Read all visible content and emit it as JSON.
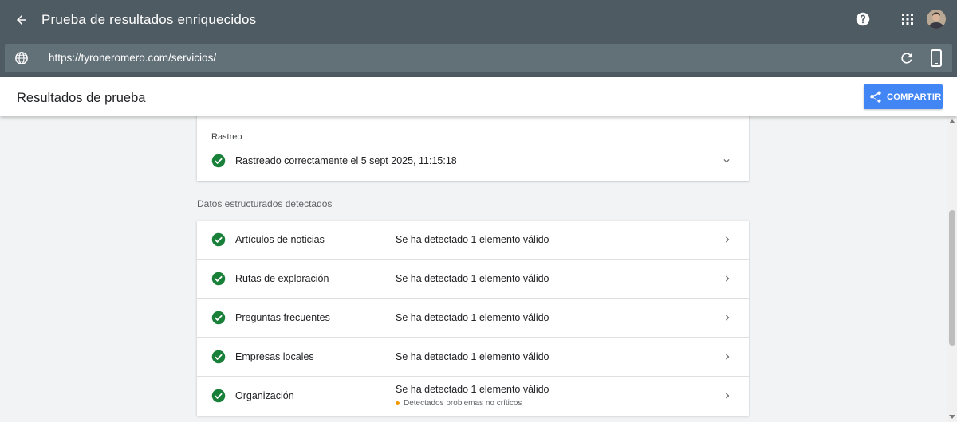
{
  "app": {
    "title": "Prueba de resultados enriquecidos"
  },
  "icons": {
    "back": "arrow-back-icon",
    "help": "help-icon",
    "apps": "apps-grid-icon",
    "globe": "globe-icon",
    "reload": "reload-icon",
    "device": "smartphone-icon",
    "share": "share-icon",
    "check": "check-circle-icon",
    "expand": "chevron-down-icon",
    "next": "chevron-right-icon"
  },
  "url": {
    "value": "https://tyroneromero.com/servicios/"
  },
  "subheader": {
    "title": "Resultados de prueba",
    "share_label": "COMPARTIR"
  },
  "crawl": {
    "label": "Rastreo",
    "status": "Rastreado correctamente el 5 sept 2025, 11:15:18"
  },
  "structured": {
    "label": "Datos estructurados detectados",
    "items": [
      {
        "name": "Artículos de noticias",
        "status": "Se ha detectado 1 elemento válido",
        "warning": ""
      },
      {
        "name": "Rutas de exploración",
        "status": "Se ha detectado 1 elemento válido",
        "warning": ""
      },
      {
        "name": "Preguntas frecuentes",
        "status": "Se ha detectado 1 elemento válido",
        "warning": ""
      },
      {
        "name": "Empresas locales",
        "status": "Se ha detectado 1 elemento válido",
        "warning": ""
      },
      {
        "name": "Organización",
        "status": "Se ha detectado 1 elemento válido",
        "warning": "Detectados problemas no críticos"
      }
    ]
  },
  "colors": {
    "topbar": "#4f5b62",
    "urlbar": "#627078",
    "accent": "#4285f4",
    "valid": "#188038",
    "warning": "#f29900"
  }
}
